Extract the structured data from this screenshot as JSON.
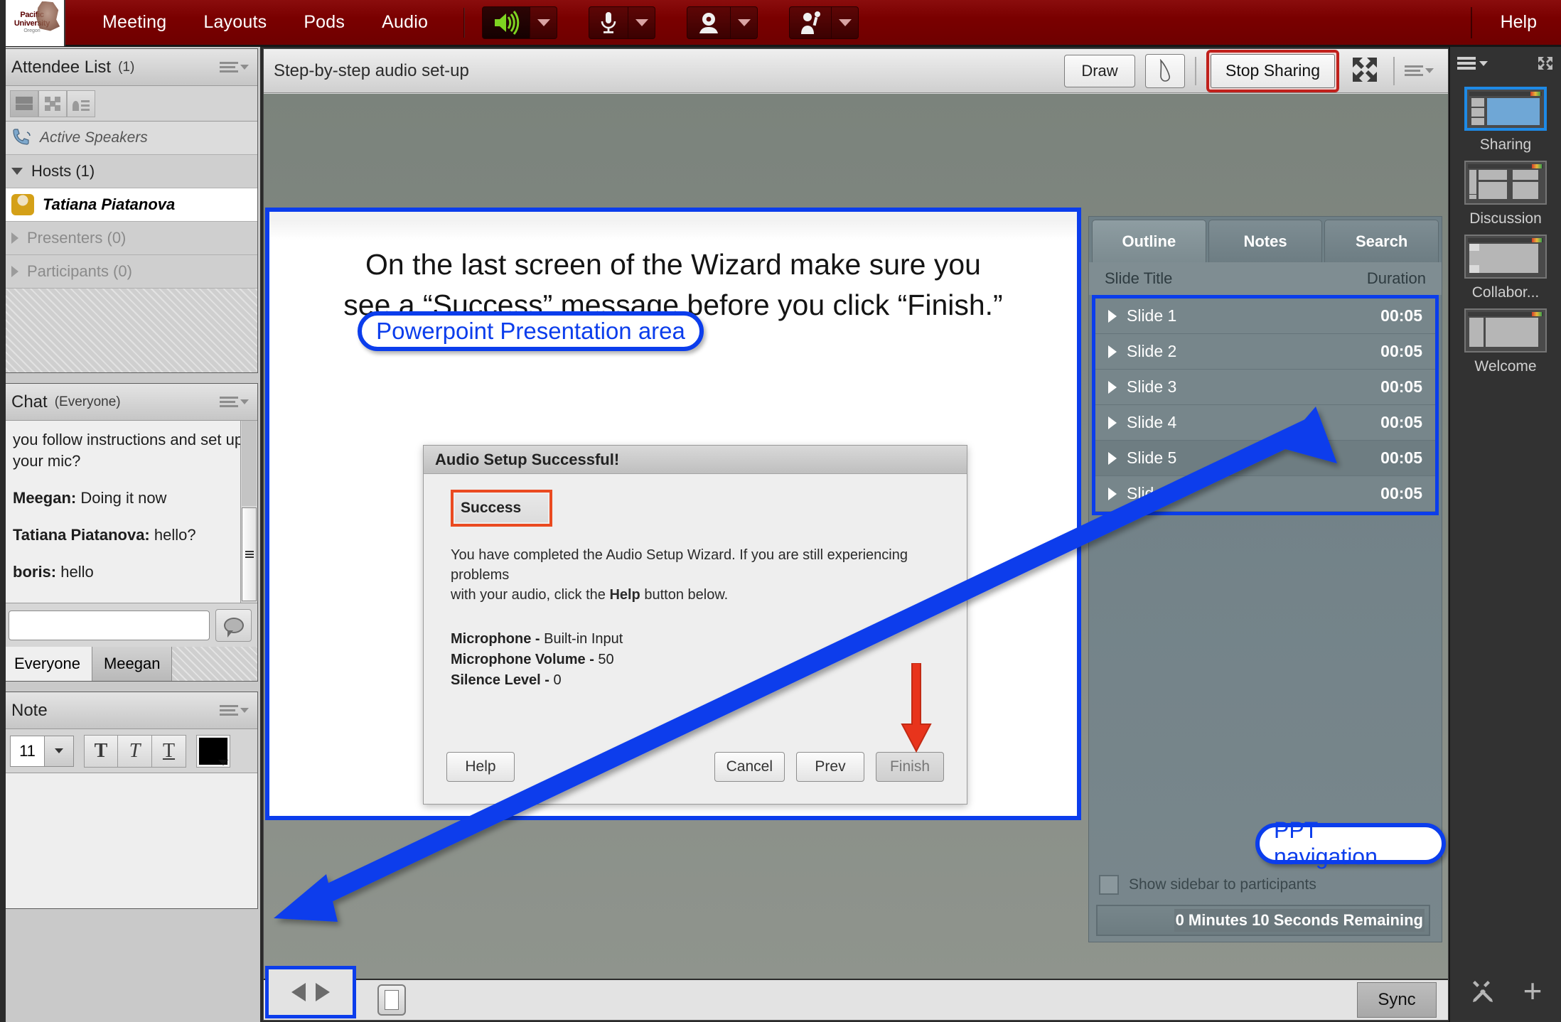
{
  "menubar": {
    "logo": {
      "line1": "Pacific",
      "line2": "University",
      "line3": "Oregon"
    },
    "items": [
      {
        "label": "Meeting",
        "name": "menu-meeting"
      },
      {
        "label": "Layouts",
        "name": "menu-layouts"
      },
      {
        "label": "Pods",
        "name": "menu-pods"
      },
      {
        "label": "Audio",
        "name": "menu-audio"
      }
    ],
    "devices": [
      {
        "icon": "speaker-icon",
        "state": "active"
      },
      {
        "icon": "microphone-icon",
        "state": "inactive"
      },
      {
        "icon": "webcam-icon",
        "state": "inactive"
      },
      {
        "icon": "raise-hand-icon",
        "state": "inactive"
      }
    ],
    "help_label": "Help"
  },
  "attendee_pod": {
    "title": "Attendee List",
    "count": "(1)",
    "view_buttons": [
      "list-view-icon",
      "grid-view-icon",
      "card-view-icon"
    ],
    "active_speakers_label": "Active Speakers",
    "groups": [
      {
        "label": "Hosts (1)",
        "expanded": true,
        "members": [
          "Tatiana Piatanova"
        ]
      },
      {
        "label": "Presenters (0)",
        "expanded": false,
        "members": []
      },
      {
        "label": "Participants (0)",
        "expanded": false,
        "members": []
      }
    ]
  },
  "chat_pod": {
    "title": "Chat",
    "scope": "(Everyone)",
    "messages": [
      {
        "who": "",
        "text": "you follow instructions and set up your mic?"
      },
      {
        "who": "Meegan:",
        "text": "Doing it now"
      },
      {
        "who": "Tatiana Piatanova:",
        "text": "hello?"
      },
      {
        "who": "boris:",
        "text": "hello"
      }
    ],
    "input_value": "",
    "input_placeholder": "",
    "send_icon": "chat-bubble-icon",
    "tabs": [
      {
        "label": "Everyone",
        "active": true
      },
      {
        "label": "Meegan",
        "active": false
      }
    ]
  },
  "note_pod": {
    "title": "Note",
    "font_size": "11",
    "bold_label": "T",
    "italic_label": "T",
    "underline_label": "T",
    "color": "#000000",
    "body_text": ""
  },
  "share_pod": {
    "title": "Step-by-step audio set-up",
    "draw_label": "Draw",
    "pointer_icon": "pointer-icon",
    "stop_sharing_label": "Stop Sharing",
    "fullscreen_icon": "fullscreen-icon",
    "menu_icon": "pod-menu-icon",
    "slide": {
      "line1": "On the last screen of the Wizard make sure you",
      "line2": "see a “Success” message before you click “Finish.”"
    },
    "callouts": [
      {
        "label": "Powerpoint Presentation area",
        "name": "callout-powerpoint-area"
      },
      {
        "label": "PPT navigation",
        "name": "callout-ppt-navigation"
      }
    ],
    "dialog": {
      "title": "Audio Setup Successful!",
      "status": "Success",
      "paragraph_a": "You have completed the Audio Setup Wizard. If you are still experiencing problems",
      "paragraph_b_pre": "with your audio, click the ",
      "paragraph_b_bold": "Help",
      "paragraph_b_post": " button below.",
      "details": [
        {
          "label": "Microphone",
          "value": "Built-in Input"
        },
        {
          "label": "Microphone Volume",
          "value": "50"
        },
        {
          "label": "Silence Level",
          "value": "0"
        }
      ],
      "help_label": "Help",
      "cancel_label": "Cancel",
      "prev_label": "Prev",
      "finish_label": "Finish"
    },
    "ppt_sidebar": {
      "tabs": [
        {
          "label": "Outline",
          "active": true
        },
        {
          "label": "Notes",
          "active": false
        },
        {
          "label": "Search",
          "active": false
        }
      ],
      "col_title": "Slide Title",
      "col_duration": "Duration",
      "slides": [
        {
          "title": "Slide 1",
          "duration": "00:05"
        },
        {
          "title": "Slide 2",
          "duration": "00:05"
        },
        {
          "title": "Slide 3",
          "duration": "00:05"
        },
        {
          "title": "Slide 4",
          "duration": "00:05"
        },
        {
          "title": "Slide 5",
          "duration": "00:05"
        },
        {
          "title": "Slide 6",
          "duration": "00:05"
        }
      ],
      "show_sidebar_label": "Show sidebar to participants",
      "show_sidebar_checked": false,
      "timer_text": "0 Minutes 10 Seconds Remaining"
    },
    "bottom_bar": {
      "prev_icon": "prev-slide-icon",
      "next_icon": "next-slide-icon",
      "slide_panel_icon": "slide-panel-icon",
      "sync_label": "Sync"
    }
  },
  "layout_rail": {
    "menu_icon": "rail-menu-icon",
    "expand_icon": "rail-expand-icon",
    "layouts": [
      {
        "label": "Sharing",
        "selected": true
      },
      {
        "label": "Discussion",
        "selected": false
      },
      {
        "label": "Collabor...",
        "selected": false
      },
      {
        "label": "Welcome",
        "selected": false
      }
    ],
    "tools_icon": "tools-icon",
    "add_icon": "plus-icon"
  },
  "colors": {
    "menubar_red": "#7a0000",
    "annotation_blue": "#0b3dec",
    "annotation_red": "#ea4a20",
    "selection_blue": "#1e8ae6",
    "share_bg": "#848b85"
  }
}
